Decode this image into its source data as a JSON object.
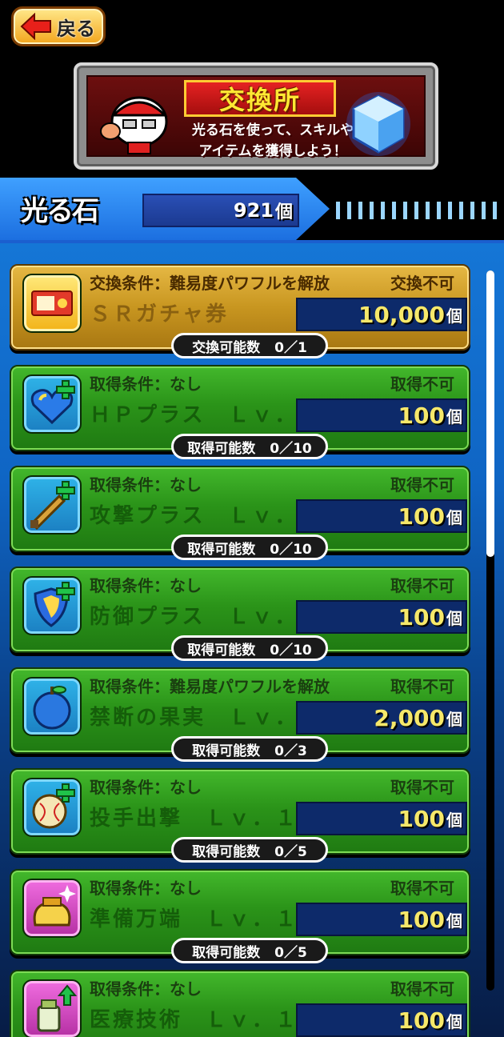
{
  "header": {
    "back_label": "戻る"
  },
  "banner": {
    "title": "交換所",
    "subtitle": "光る石を使って、スキルや\nアイテムを獲得しよう！"
  },
  "currency": {
    "label": "光る石",
    "value": "921",
    "unit": "個"
  },
  "items": [
    {
      "condition": "交換条件：難易度パワフルを解放",
      "status": "交換不可",
      "name": "ＳＲガチャ券",
      "price": "10,000",
      "unit": "個",
      "count_label": "交換可能数",
      "count": "0／1",
      "icon": "gacha-ticket-icon",
      "style": "gold"
    },
    {
      "condition": "取得条件：なし",
      "status": "取得不可",
      "name": "ＨＰプラス　Ｌｖ．１",
      "price": "100",
      "unit": "個",
      "count_label": "取得可能数",
      "count": "0／10",
      "icon": "heart-plus-icon",
      "style": "green"
    },
    {
      "condition": "取得条件：なし",
      "status": "取得不可",
      "name": "攻撃プラス　Ｌｖ．１",
      "price": "100",
      "unit": "個",
      "count_label": "取得可能数",
      "count": "0／10",
      "icon": "sword-plus-icon",
      "style": "green"
    },
    {
      "condition": "取得条件：なし",
      "status": "取得不可",
      "name": "防御プラス　Ｌｖ．１",
      "price": "100",
      "unit": "個",
      "count_label": "取得可能数",
      "count": "0／10",
      "icon": "shield-plus-icon",
      "style": "green"
    },
    {
      "condition": "取得条件：難易度パワフルを解放",
      "status": "取得不可",
      "name": "禁断の果実　Ｌｖ．１",
      "price": "2,000",
      "unit": "個",
      "count_label": "取得可能数",
      "count": "0／3",
      "icon": "fruit-icon",
      "style": "green"
    },
    {
      "condition": "取得条件：なし",
      "status": "取得不可",
      "name": "投手出撃　Ｌｖ．１",
      "price": "100",
      "unit": "個",
      "count_label": "取得可能数",
      "count": "0／5",
      "icon": "baseball-plus-icon",
      "style": "green"
    },
    {
      "condition": "取得条件：なし",
      "status": "取得不可",
      "name": "準備万端　Ｌｖ．１",
      "price": "100",
      "unit": "個",
      "count_label": "取得可能数",
      "count": "0／5",
      "icon": "bag-sparkle-icon",
      "style": "green"
    },
    {
      "condition": "取得条件：なし",
      "status": "取得不可",
      "name": "医療技術　Ｌｖ．１",
      "price": "100",
      "unit": "個",
      "count_label": "",
      "count": "",
      "icon": "medicine-bottle-icon",
      "style": "green"
    }
  ],
  "colors": {
    "accent_blue": "#1c6fe0",
    "card_green": "#2b9419",
    "card_gold": "#c89620",
    "price_yellow": "#f6e86a"
  }
}
